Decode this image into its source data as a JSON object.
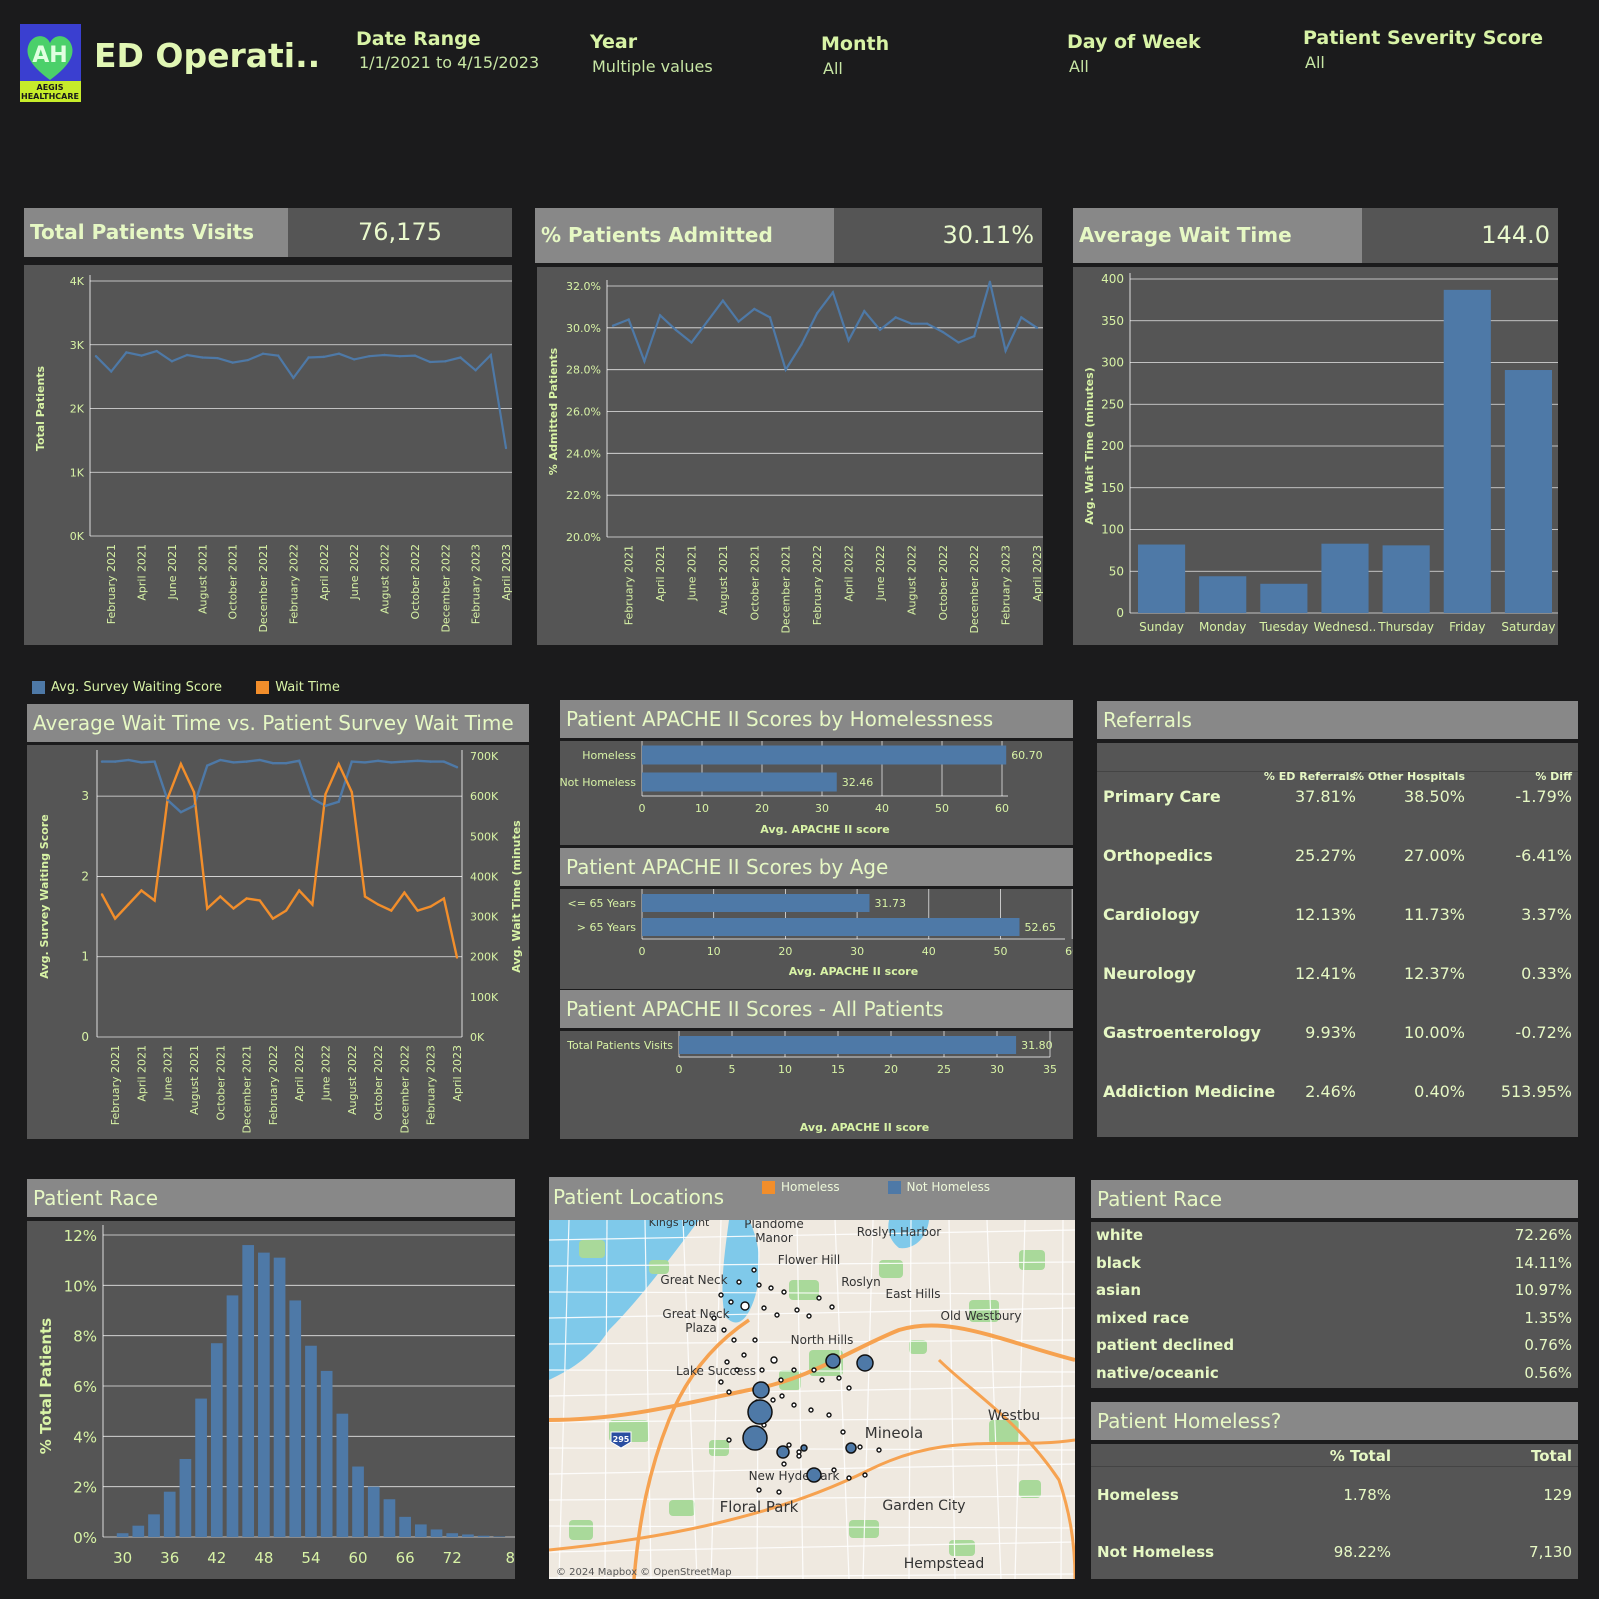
{
  "header": {
    "title": "ED Operati..",
    "logo_text": "AH",
    "logo_caption_1": "AEGIS",
    "logo_caption_2": "HEALTHCARE",
    "filters": [
      {
        "label": "Date Range",
        "value": "1/1/2021 to 4/15/2023"
      },
      {
        "label": "Year",
        "value": "Multiple values"
      },
      {
        "label": "Month",
        "value": "All"
      },
      {
        "label": "Day of Week",
        "value": "All"
      },
      {
        "label": "Patient Severity Score",
        "value": "All"
      }
    ]
  },
  "kpis": [
    {
      "label": "Total Patients Visits",
      "value": "76,175"
    },
    {
      "label": "% Patients Admitted",
      "value": "30.11%"
    },
    {
      "label": "Average Wait Time (minutes)",
      "value": "144.0"
    }
  ],
  "colors": {
    "blue": "#4e79a7",
    "orange": "#f28e2b",
    "panel": "#555555",
    "title_bg": "#888888",
    "text": "#d8f3a6"
  },
  "month_ticks": [
    "February 2021",
    "April 2021",
    "June 2021",
    "August 2021",
    "October 2021",
    "December 2021",
    "February 2022",
    "April 2022",
    "June 2022",
    "August 2022",
    "October 2022",
    "December 2022",
    "February 2023",
    "April 2023"
  ],
  "chart_data": [
    {
      "type": "line",
      "ylabel": "Total Patients",
      "yticks": [
        "0K",
        "1K",
        "2K",
        "3K",
        "4K"
      ],
      "ylim": [
        0,
        4000
      ],
      "x": [
        "Jan 2021",
        "Feb 2021",
        "Mar 2021",
        "Apr 2021",
        "May 2021",
        "Jun 2021",
        "Jul 2021",
        "Aug 2021",
        "Sep 2021",
        "Oct 2021",
        "Nov 2021",
        "Dec 2021",
        "Jan 2022",
        "Feb 2022",
        "Mar 2022",
        "Apr 2022",
        "May 2022",
        "Jun 2022",
        "Jul 2022",
        "Aug 2022",
        "Sep 2022",
        "Oct 2022",
        "Nov 2022",
        "Dec 2022",
        "Jan 2023",
        "Feb 2023",
        "Mar 2023",
        "Apr 2023"
      ],
      "values": [
        2820,
        2580,
        2880,
        2830,
        2900,
        2740,
        2840,
        2800,
        2790,
        2720,
        2760,
        2860,
        2830,
        2480,
        2800,
        2810,
        2860,
        2770,
        2820,
        2840,
        2820,
        2830,
        2730,
        2740,
        2800,
        2600,
        2840,
        1380
      ]
    },
    {
      "type": "line",
      "ylabel": "% Admitted Patients",
      "yticks": [
        "20.0%",
        "22.0%",
        "24.0%",
        "26.0%",
        "28.0%",
        "30.0%",
        "32.0%"
      ],
      "ylim": [
        20,
        32
      ],
      "x": [
        "Jan 2021",
        "Feb 2021",
        "Mar 2021",
        "Apr 2021",
        "May 2021",
        "Jun 2021",
        "Jul 2021",
        "Aug 2021",
        "Sep 2021",
        "Oct 2021",
        "Nov 2021",
        "Dec 2021",
        "Jan 2022",
        "Feb 2022",
        "Mar 2022",
        "Apr 2022",
        "May 2022",
        "Jun 2022",
        "Jul 2022",
        "Aug 2022",
        "Sep 2022",
        "Oct 2022",
        "Nov 2022",
        "Dec 2022",
        "Jan 2023",
        "Feb 2023",
        "Mar 2023",
        "Apr 2023"
      ],
      "values": [
        30.1,
        30.4,
        28.4,
        30.6,
        29.9,
        29.3,
        30.3,
        31.3,
        30.3,
        30.9,
        30.5,
        28.0,
        29.2,
        30.7,
        31.7,
        29.4,
        30.8,
        29.9,
        30.5,
        30.2,
        30.2,
        29.8,
        29.3,
        29.6,
        32.2,
        28.9,
        30.5,
        30.0
      ]
    },
    {
      "type": "bar",
      "ylabel": "Avg. Wait Time (minutes)",
      "yticks": [
        "0",
        "50",
        "100",
        "150",
        "200",
        "250",
        "300",
        "350",
        "400"
      ],
      "ylim": [
        0,
        400
      ],
      "categories": [
        "Sunday",
        "Monday",
        "Tuesday",
        "Wednesd..",
        "Thursday",
        "Friday",
        "Saturday"
      ],
      "values": [
        82,
        44,
        35,
        83,
        81,
        387,
        291
      ]
    },
    {
      "type": "line",
      "title": "Average Wait Time vs. Patient Survey Wait Time Score",
      "ylabel": "Avg. Survey Waiting Score",
      "y2label": "Avg. Wait Time (minutes",
      "yticks": [
        "0",
        "1",
        "2",
        "3"
      ],
      "y2ticks": [
        "0K",
        "100K",
        "200K",
        "300K",
        "400K",
        "500K",
        "600K",
        "700K"
      ],
      "ylim": [
        0,
        3.5
      ],
      "y2lim": [
        0,
        700000
      ],
      "legend": [
        "Avg. Survey Waiting Score",
        "Wait Time"
      ],
      "x": [
        "Jan 2021",
        "Feb 2021",
        "Mar 2021",
        "Apr 2021",
        "May 2021",
        "Jun 2021",
        "Jul 2021",
        "Aug 2021",
        "Sep 2021",
        "Oct 2021",
        "Nov 2021",
        "Dec 2021",
        "Jan 2022",
        "Feb 2022",
        "Mar 2022",
        "Apr 2022",
        "May 2022",
        "Jun 2022",
        "Jul 2022",
        "Aug 2022",
        "Sep 2022",
        "Oct 2022",
        "Nov 2022",
        "Dec 2022",
        "Jan 2023",
        "Feb 2023",
        "Mar 2023",
        "Apr 2023"
      ],
      "series": [
        {
          "name": "Avg. Survey Waiting Score",
          "values": [
            3.43,
            3.43,
            3.45,
            3.42,
            3.43,
            2.95,
            2.8,
            2.88,
            3.38,
            3.45,
            3.42,
            3.43,
            3.45,
            3.41,
            3.41,
            3.44,
            2.97,
            2.88,
            2.93,
            3.43,
            3.42,
            3.44,
            3.42,
            3.43,
            3.44,
            3.43,
            3.43,
            3.36
          ]
        },
        {
          "name": "Wait Time",
          "values": [
            355000,
            295000,
            330000,
            365000,
            340000,
            595000,
            680000,
            610000,
            320000,
            350000,
            320000,
            345000,
            340000,
            295000,
            315000,
            365000,
            330000,
            605000,
            680000,
            610000,
            350000,
            330000,
            315000,
            360000,
            315000,
            325000,
            345000,
            198000
          ]
        }
      ]
    },
    {
      "type": "bar",
      "title": "Patient APACHE II Scores by Homelessness",
      "xlabel": "Avg. APACHE II score",
      "xticks": [
        "0",
        "10",
        "20",
        "30",
        "40",
        "50",
        "60"
      ],
      "xlim": [
        0,
        61
      ],
      "categories": [
        "Homeless",
        "Not Homeless"
      ],
      "values": [
        60.7,
        32.46
      ],
      "labels": [
        "60.70",
        "32.46"
      ]
    },
    {
      "type": "bar",
      "title": "Patient APACHE II Scores by Age",
      "xlabel": "Avg. APACHE II score",
      "xticks": [
        "0",
        "10",
        "20",
        "30",
        "40",
        "50",
        "60"
      ],
      "xlim": [
        0,
        59
      ],
      "categories": [
        "<= 65 Years",
        "> 65 Years"
      ],
      "values": [
        31.73,
        52.65
      ],
      "labels": [
        "31.73",
        "52.65"
      ]
    },
    {
      "type": "bar",
      "title": "Patient APACHE II Scores - All Patients",
      "xlabel": "Avg. APACHE II score",
      "xticks": [
        "0",
        "5",
        "10",
        "15",
        "20",
        "25",
        "30",
        "35"
      ],
      "xlim": [
        0,
        35
      ],
      "categories": [
        "Total Patients Visits"
      ],
      "values": [
        31.8
      ],
      "labels": [
        "31.80"
      ]
    },
    {
      "type": "bar",
      "title": "Patient Race",
      "ylabel": "% Total Patients",
      "yticks": [
        "0%",
        "2%",
        "4%",
        "6%",
        "8%",
        "10%",
        "12%"
      ],
      "ylim": [
        0,
        12
      ],
      "xticks": [
        "30",
        "36",
        "42",
        "48",
        "54",
        "60",
        "66",
        "72",
        "80"
      ],
      "x": [
        29,
        30,
        31,
        32,
        33,
        34,
        35,
        36,
        37,
        38,
        39,
        40,
        41,
        42,
        43,
        44,
        45,
        46,
        47,
        48,
        49,
        50,
        51,
        52,
        53,
        54,
        55,
        56,
        57,
        58,
        59,
        60,
        61,
        62,
        63,
        64
      ],
      "values": [
        0.15,
        0.45,
        0.9,
        1.8,
        3.1,
        5.5,
        7.7,
        9.6,
        11.6,
        11.3,
        11.1,
        9.4,
        7.6,
        6.6,
        4.9,
        2.8,
        2.0,
        1.5,
        0.8,
        0.5,
        0.3,
        0.15,
        0.1,
        0.05,
        0.02,
        0,
        0,
        0,
        0,
        0,
        0,
        0,
        0,
        0,
        0,
        0
      ]
    }
  ],
  "referrals": {
    "title": "Referrals",
    "headers": [
      "% ED Referrals",
      "% Other Hospitals",
      "% Diff"
    ],
    "rows": [
      {
        "name": "Primary Care",
        "ed": "37.81%",
        "other": "38.50%",
        "diff": "-1.79%"
      },
      {
        "name": "Orthopedics",
        "ed": "25.27%",
        "other": "27.00%",
        "diff": "-6.41%"
      },
      {
        "name": "Cardiology",
        "ed": "12.13%",
        "other": "11.73%",
        "diff": "3.37%"
      },
      {
        "name": "Neurology",
        "ed": "12.41%",
        "other": "12.37%",
        "diff": "0.33%"
      },
      {
        "name": "Gastroenterology",
        "ed": "9.93%",
        "other": "10.00%",
        "diff": "-0.72%"
      },
      {
        "name": "Addiction Medicine",
        "ed": "2.46%",
        "other": "0.40%",
        "diff": "513.95%"
      }
    ]
  },
  "map": {
    "title": "Patient Locations",
    "legend": [
      "Homeless",
      "Not Homeless"
    ],
    "places": [
      "Kings Point",
      "Plandome",
      "Manor",
      "Roslyn Harbor",
      "Flower Hill",
      "Great Neck",
      "Roslyn",
      "East Hills",
      "Great Neck",
      "Plaza",
      "Old Westbury",
      "North Hills",
      "Lake Success",
      "Westbu",
      "Mineola",
      "New Hyde Park",
      "Garden City",
      "Floral Park",
      "Hempstead"
    ],
    "highway": "295",
    "credit": "© 2024 Mapbox © OpenStreetMap"
  },
  "race_table": {
    "title": "Patient Race",
    "rows": [
      {
        "name": "white",
        "value": "72.26%"
      },
      {
        "name": "black",
        "value": "14.11%"
      },
      {
        "name": "asian",
        "value": "10.97%"
      },
      {
        "name": "mixed race",
        "value": "1.35%"
      },
      {
        "name": "patient declined",
        "value": "0.76%"
      },
      {
        "name": "native/oceanic",
        "value": "0.56%"
      }
    ]
  },
  "homeless_table": {
    "title": "Patient Homeless?",
    "headers": [
      "% Total",
      "Total"
    ],
    "rows": [
      {
        "name": "Homeless",
        "pct": "1.78%",
        "total": "129"
      },
      {
        "name": "Not Homeless",
        "pct": "98.22%",
        "total": "7,130"
      }
    ]
  }
}
